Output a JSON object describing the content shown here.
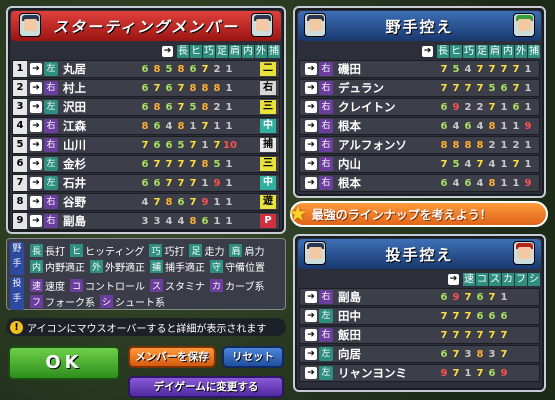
{
  "left": {
    "title": "スターティングメンバー",
    "cols": [
      "長",
      "ヒ",
      "巧",
      "足",
      "肩",
      "内",
      "外",
      "捕"
    ],
    "rows": [
      {
        "num": "1",
        "hand": "左",
        "name": "丸居",
        "stats": [
          "6",
          "8",
          "5",
          "8",
          "6",
          "7",
          "2",
          "1"
        ],
        "pos": "二",
        "posColor": "#e8e23a"
      },
      {
        "num": "2",
        "hand": "右",
        "name": "村上",
        "stats": [
          "6",
          "7",
          "6",
          "7",
          "8",
          "8",
          "8",
          "1"
        ],
        "pos": "右",
        "posColor": "#d6d6d6"
      },
      {
        "num": "3",
        "hand": "左",
        "name": "沢田",
        "stats": [
          "6",
          "8",
          "6",
          "7",
          "5",
          "8",
          "2",
          "1"
        ],
        "pos": "三",
        "posColor": "#e8e23a"
      },
      {
        "num": "4",
        "hand": "右",
        "name": "江森",
        "stats": [
          "8",
          "6",
          "4",
          "8",
          "1",
          "7",
          "1",
          "1"
        ],
        "pos": "中",
        "posColor": "#30b0a0"
      },
      {
        "num": "5",
        "hand": "右",
        "name": "山川",
        "stats": [
          "7",
          "6",
          "6",
          "5",
          "7",
          "1",
          "7",
          "10"
        ],
        "pos": "捕",
        "posColor": "#e8e8e8"
      },
      {
        "num": "6",
        "hand": "左",
        "name": "金杉",
        "stats": [
          "6",
          "7",
          "7",
          "7",
          "7",
          "8",
          "5",
          "1"
        ],
        "pos": "三",
        "posColor": "#e8e23a"
      },
      {
        "num": "7",
        "hand": "左",
        "name": "石井",
        "stats": [
          "6",
          "6",
          "7",
          "7",
          "7",
          "1",
          "9",
          "1"
        ],
        "pos": "中",
        "posColor": "#30b0a0"
      },
      {
        "num": "8",
        "hand": "右",
        "name": "谷野",
        "stats": [
          "4",
          "7",
          "8",
          "6",
          "7",
          "9",
          "1",
          "1"
        ],
        "pos": "遊",
        "posColor": "#e8e23a"
      },
      {
        "num": "9",
        "hand": "右",
        "name": "副島",
        "stats": [
          "3",
          "3",
          "4",
          "4",
          "8",
          "6",
          "1",
          "1"
        ],
        "pos": "P",
        "posColor": "#d03040"
      }
    ]
  },
  "fielders": {
    "title": "野手控え",
    "cols": [
      "長",
      "ヒ",
      "巧",
      "足",
      "肩",
      "内",
      "外",
      "捕"
    ],
    "rows": [
      {
        "hand": "右",
        "name": "磯田",
        "stats": [
          "7",
          "5",
          "4",
          "7",
          "7",
          "7",
          "7",
          "1"
        ]
      },
      {
        "hand": "右",
        "name": "デュラン",
        "stats": [
          "7",
          "7",
          "7",
          "7",
          "5",
          "6",
          "7",
          "1"
        ]
      },
      {
        "hand": "右",
        "name": "クレイトン",
        "stats": [
          "6",
          "9",
          "2",
          "2",
          "7",
          "1",
          "6",
          "1"
        ]
      },
      {
        "hand": "右",
        "name": "根本",
        "stats": [
          "6",
          "4",
          "6",
          "4",
          "8",
          "1",
          "1",
          "9"
        ]
      },
      {
        "hand": "右",
        "name": "アルフォンソ",
        "stats": [
          "8",
          "8",
          "8",
          "8",
          "2",
          "1",
          "2",
          "1"
        ]
      },
      {
        "hand": "右",
        "name": "内山",
        "stats": [
          "7",
          "5",
          "4",
          "7",
          "4",
          "1",
          "7",
          "1"
        ]
      },
      {
        "hand": "右",
        "name": "根本",
        "stats": [
          "6",
          "4",
          "6",
          "4",
          "8",
          "1",
          "1",
          "9"
        ]
      }
    ]
  },
  "banner": "最強のラインナップを考えよう！",
  "pitchers": {
    "title": "投手控え",
    "cols": [
      "速",
      "コ",
      "ス",
      "カ",
      "フ",
      "シ"
    ],
    "rows": [
      {
        "hand": "右",
        "name": "副島",
        "stats": [
          "6",
          "9",
          "7",
          "6",
          "7",
          "1"
        ]
      },
      {
        "hand": "左",
        "name": "田中",
        "stats": [
          "7",
          "7",
          "7",
          "6",
          "6",
          "6"
        ]
      },
      {
        "hand": "右",
        "name": "飯田",
        "stats": [
          "7",
          "7",
          "7",
          "7",
          "7",
          "7"
        ]
      },
      {
        "hand": "左",
        "name": "向居",
        "stats": [
          "6",
          "7",
          "3",
          "8",
          "3",
          "7"
        ]
      },
      {
        "hand": "左",
        "name": "リャンヨンミ",
        "stats": [
          "9",
          "7",
          "1",
          "7",
          "6",
          "9"
        ]
      }
    ]
  },
  "legend": {
    "fielder_side": "野手",
    "pitcher_side": "投手",
    "line1": [
      [
        "長",
        "長打"
      ],
      [
        "ヒ",
        "ヒッティング"
      ],
      [
        "巧",
        "巧打"
      ],
      [
        "足",
        "走力"
      ],
      [
        "肩",
        "肩力"
      ]
    ],
    "line2": [
      [
        "内",
        "内野適正"
      ],
      [
        "外",
        "外野適正"
      ],
      [
        "捕",
        "捕手適正"
      ],
      [
        "守",
        "守備位置"
      ]
    ],
    "line3": [
      [
        "速",
        "速度"
      ],
      [
        "コ",
        "コントロール"
      ],
      [
        "ス",
        "スタミナ"
      ],
      [
        "カ",
        "カーブ系"
      ]
    ],
    "line4": [
      [
        "フ",
        "フォーク系"
      ],
      [
        "シ",
        "シュート系"
      ]
    ]
  },
  "notice": "アイコンにマウスオーバーすると詳細が表示されます",
  "notice_icon": "!",
  "buttons": {
    "ok": "OK",
    "save": "メンバーを保存",
    "reset": "リセット",
    "day": "デイゲームに変更する"
  }
}
